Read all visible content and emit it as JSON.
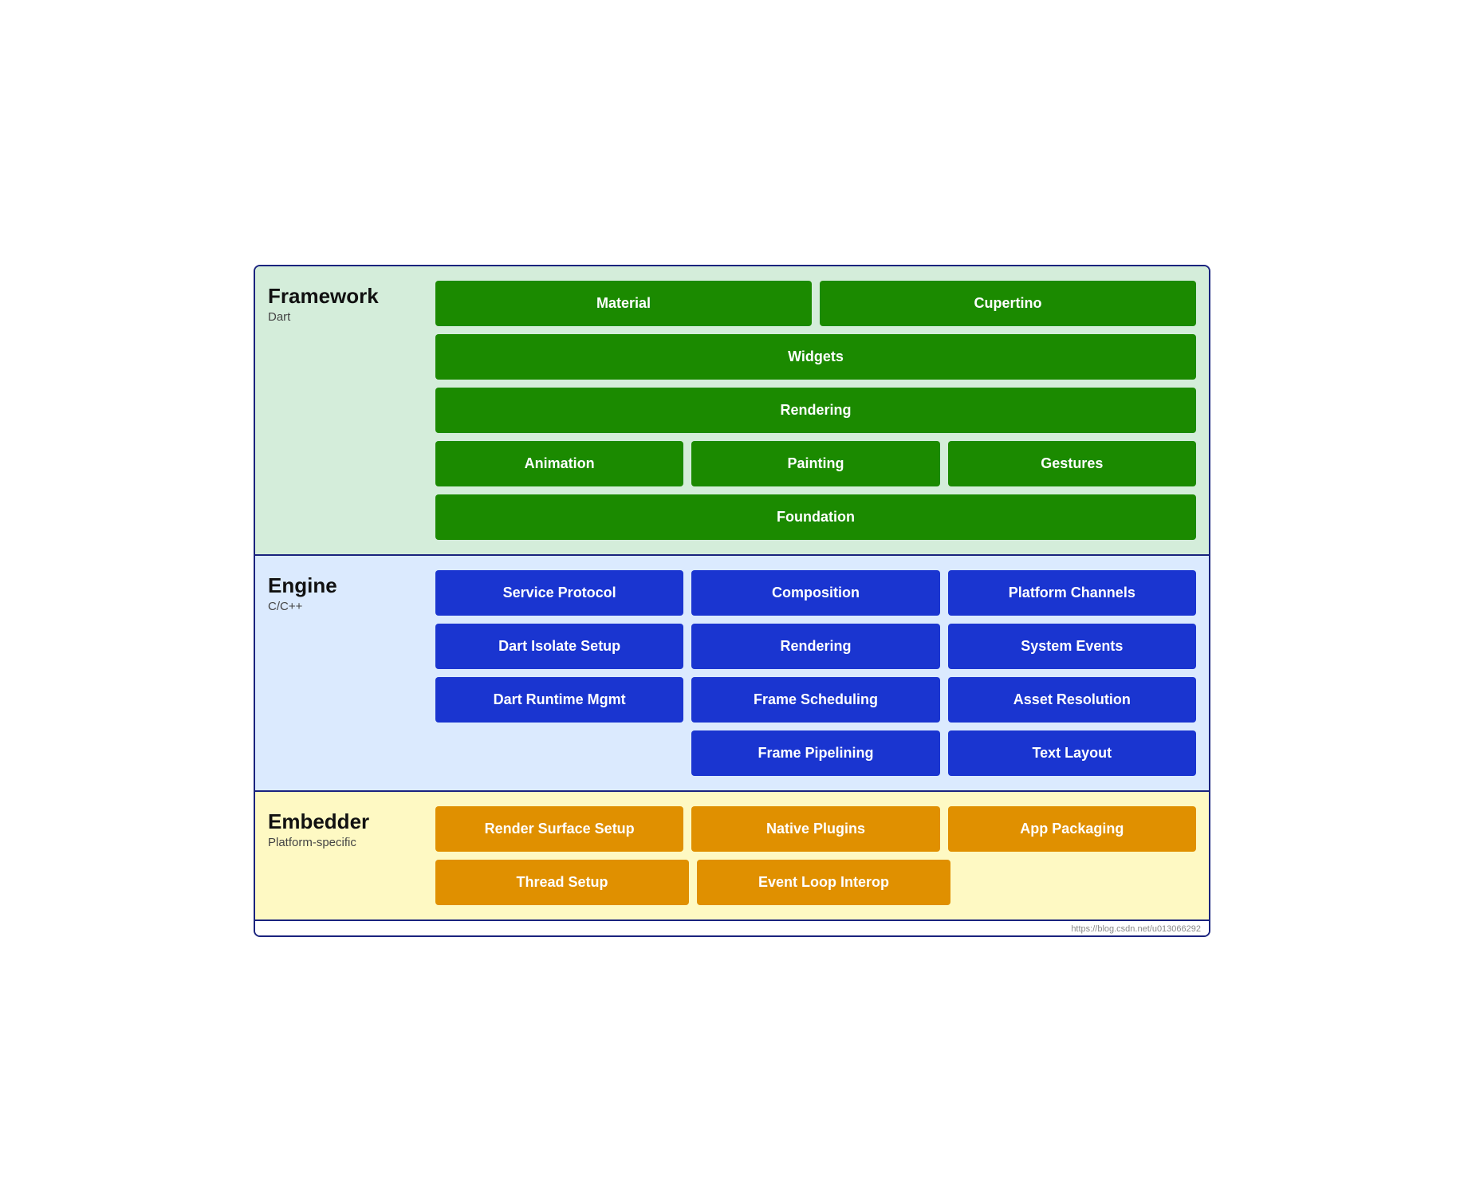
{
  "framework": {
    "title": "Framework",
    "subtitle": "Dart",
    "rows": [
      [
        {
          "label": "Material"
        },
        {
          "label": "Cupertino"
        }
      ],
      [
        {
          "label": "Widgets"
        }
      ],
      [
        {
          "label": "Rendering"
        }
      ],
      [
        {
          "label": "Animation"
        },
        {
          "label": "Painting"
        },
        {
          "label": "Gestures"
        }
      ],
      [
        {
          "label": "Foundation"
        }
      ]
    ]
  },
  "engine": {
    "title": "Engine",
    "subtitle": "C/C++",
    "rows": [
      [
        {
          "label": "Service Protocol"
        },
        {
          "label": "Composition"
        },
        {
          "label": "Platform Channels"
        }
      ],
      [
        {
          "label": "Dart Isolate Setup"
        },
        {
          "label": "Rendering"
        },
        {
          "label": "System Events"
        }
      ],
      [
        {
          "label": "Dart Runtime Mgmt"
        },
        {
          "label": "Frame Scheduling"
        },
        {
          "label": "Asset Resolution"
        }
      ],
      [
        {
          "label": ""
        },
        {
          "label": "Frame Pipelining"
        },
        {
          "label": "Text Layout"
        }
      ]
    ]
  },
  "embedder": {
    "title": "Embedder",
    "subtitle": "Platform-specific",
    "rows": [
      [
        {
          "label": "Render Surface Setup"
        },
        {
          "label": "Native Plugins"
        },
        {
          "label": "App Packaging"
        }
      ],
      [
        {
          "label": "Thread Setup"
        },
        {
          "label": "Event Loop Interop"
        }
      ]
    ]
  },
  "watermark": "https://blog.csdn.net/u013066292"
}
